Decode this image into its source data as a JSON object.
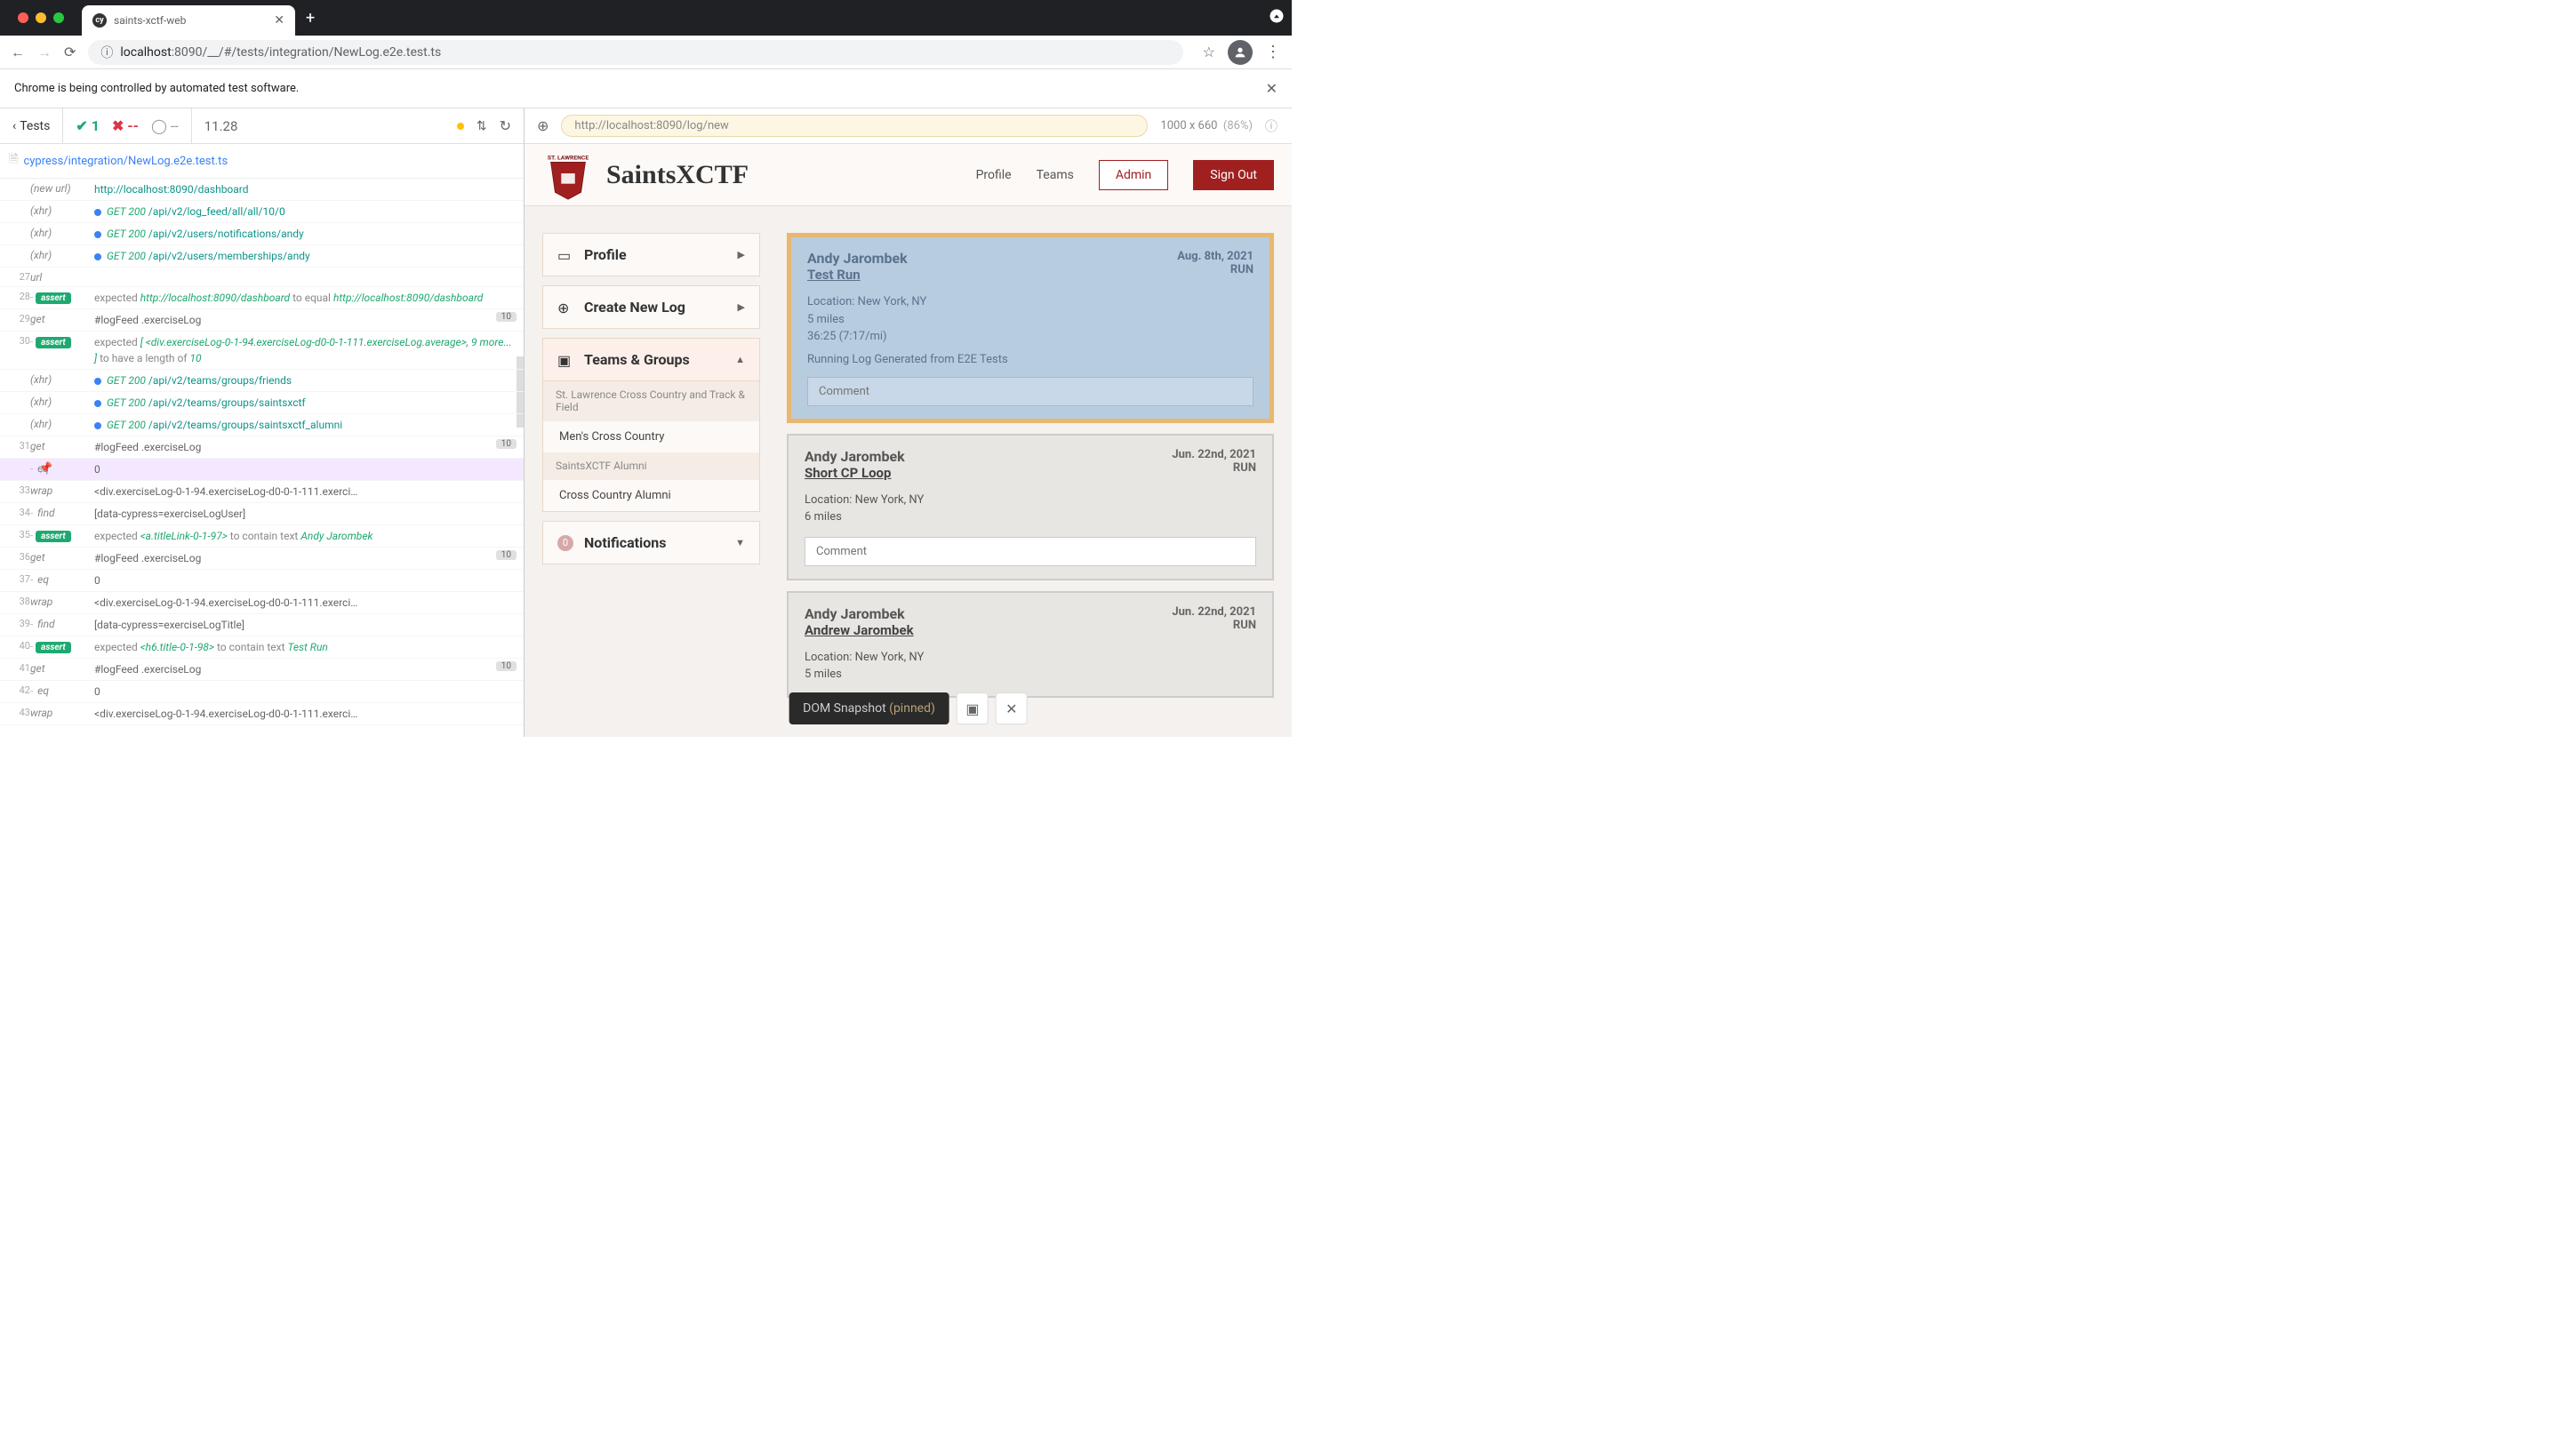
{
  "browser": {
    "tab_title": "saints-xctf-web",
    "url_host": "localhost",
    "url_port_path": ":8090/__/#/tests/integration/NewLog.e2e.test.ts",
    "automation_msg": "Chrome is being controlled by automated test software."
  },
  "cypress": {
    "tests_label": "Tests",
    "pass_count": "1",
    "fail_count": "--",
    "pending_count": "--",
    "duration": "11.28",
    "file_path": "cypress/integration/NewLog.e2e.test.ts",
    "preview_url": "http://localhost:8090/log/new",
    "viewport_size": "1000 x 660",
    "viewport_pct": "(86%)",
    "snapshot_label": "DOM Snapshot",
    "snapshot_state": "(pinned)",
    "commands": [
      {
        "num": "",
        "name": "(new url)",
        "msg_parts": [
          {
            "t": "teal",
            "v": "http://localhost:8090/dashboard"
          }
        ]
      },
      {
        "num": "",
        "name": "(xhr)",
        "dot": true,
        "msg_parts": [
          {
            "t": "green",
            "v": "GET 200 "
          },
          {
            "t": "teal",
            "v": "/api/v2/log_feed/all/all/10/0"
          }
        ]
      },
      {
        "num": "",
        "name": "(xhr)",
        "dot": true,
        "msg_parts": [
          {
            "t": "green",
            "v": "GET 200 "
          },
          {
            "t": "teal",
            "v": "/api/v2/users/notifications/andy"
          }
        ]
      },
      {
        "num": "",
        "name": "(xhr)",
        "dot": true,
        "msg_parts": [
          {
            "t": "green",
            "v": "GET 200 "
          },
          {
            "t": "teal",
            "v": "/api/v2/users/memberships/andy"
          }
        ]
      },
      {
        "num": "27",
        "name": "url",
        "msg_parts": []
      },
      {
        "num": "28",
        "name": "assert",
        "assert": true,
        "child": true,
        "msg_parts": [
          {
            "t": "exp",
            "v": "expected "
          },
          {
            "t": "green",
            "v": "http://localhost:8090/dashboard"
          },
          {
            "t": "exp",
            "v": " to equal "
          },
          {
            "t": "green",
            "v": "http://localhost:8090/dashboard"
          }
        ]
      },
      {
        "num": "29",
        "name": "get",
        "msg_parts": [
          {
            "t": "plain",
            "v": "#logFeed .exerciseLog"
          }
        ],
        "badge": "10"
      },
      {
        "num": "30",
        "name": "assert",
        "assert": true,
        "child": true,
        "msg_parts": [
          {
            "t": "exp",
            "v": "expected "
          },
          {
            "t": "green",
            "v": "[ <div.exerciseLog-0-1-94.exerciseLog-d0-0-1-111.exerciseLog.average>, 9 more... ]"
          },
          {
            "t": "exp",
            "v": " to have a length of "
          },
          {
            "t": "green",
            "v": "10"
          }
        ]
      },
      {
        "num": "",
        "name": "(xhr)",
        "dot": true,
        "msg_parts": [
          {
            "t": "green",
            "v": "GET 200 "
          },
          {
            "t": "teal",
            "v": "/api/v2/teams/groups/friends"
          }
        ]
      },
      {
        "num": "",
        "name": "(xhr)",
        "dot": true,
        "msg_parts": [
          {
            "t": "green",
            "v": "GET 200 "
          },
          {
            "t": "teal",
            "v": "/api/v2/teams/groups/saintsxctf"
          }
        ]
      },
      {
        "num": "",
        "name": "(xhr)",
        "dot": true,
        "msg_parts": [
          {
            "t": "green",
            "v": "GET 200 "
          },
          {
            "t": "teal",
            "v": "/api/v2/teams/groups/saintsxctf_alumni"
          }
        ]
      },
      {
        "num": "31",
        "name": "get",
        "msg_parts": [
          {
            "t": "plain",
            "v": "#logFeed .exerciseLog"
          }
        ],
        "badge": "10"
      },
      {
        "num": "",
        "name": "eq",
        "child": true,
        "highlight": true,
        "pin": true,
        "msg_parts": [
          {
            "t": "plain",
            "v": "0"
          }
        ]
      },
      {
        "num": "33",
        "name": "wrap",
        "msg_parts": [
          {
            "t": "plain",
            "v": "<div.exerciseLog-0-1-94.exerciseLog-d0-0-1-111.exerci…"
          }
        ]
      },
      {
        "num": "34",
        "name": "find",
        "child": true,
        "msg_parts": [
          {
            "t": "plain",
            "v": "[data-cypress=exerciseLogUser]"
          }
        ]
      },
      {
        "num": "35",
        "name": "assert",
        "assert": true,
        "child": true,
        "msg_parts": [
          {
            "t": "exp",
            "v": "expected "
          },
          {
            "t": "green",
            "v": "<a.titleLink-0-1-97>"
          },
          {
            "t": "exp",
            "v": " to contain text "
          },
          {
            "t": "green",
            "v": "Andy Jarombek"
          }
        ]
      },
      {
        "num": "36",
        "name": "get",
        "msg_parts": [
          {
            "t": "plain",
            "v": "#logFeed .exerciseLog"
          }
        ],
        "badge": "10"
      },
      {
        "num": "37",
        "name": "eq",
        "child": true,
        "msg_parts": [
          {
            "t": "plain",
            "v": "0"
          }
        ]
      },
      {
        "num": "38",
        "name": "wrap",
        "msg_parts": [
          {
            "t": "plain",
            "v": "<div.exerciseLog-0-1-94.exerciseLog-d0-0-1-111.exerci…"
          }
        ]
      },
      {
        "num": "39",
        "name": "find",
        "child": true,
        "msg_parts": [
          {
            "t": "plain",
            "v": "[data-cypress=exerciseLogTitle]"
          }
        ]
      },
      {
        "num": "40",
        "name": "assert",
        "assert": true,
        "child": true,
        "msg_parts": [
          {
            "t": "exp",
            "v": "expected "
          },
          {
            "t": "green",
            "v": "<h6.title-0-1-98>"
          },
          {
            "t": "exp",
            "v": " to contain text "
          },
          {
            "t": "green",
            "v": "Test Run"
          }
        ]
      },
      {
        "num": "41",
        "name": "get",
        "msg_parts": [
          {
            "t": "plain",
            "v": "#logFeed .exerciseLog"
          }
        ],
        "badge": "10"
      },
      {
        "num": "42",
        "name": "eq",
        "child": true,
        "msg_parts": [
          {
            "t": "plain",
            "v": "0"
          }
        ]
      },
      {
        "num": "43",
        "name": "wrap",
        "msg_parts": [
          {
            "t": "plain",
            "v": "<div.exerciseLog-0-1-94.exerciseLog-d0-0-1-111.exerci…"
          }
        ]
      }
    ]
  },
  "app": {
    "logo_text_top": "ST. LAWRENCE",
    "title": "SaintsXCTF",
    "nav": {
      "profile": "Profile",
      "teams": "Teams",
      "admin": "Admin",
      "signout": "Sign Out"
    },
    "sidebar": {
      "profile": "Profile",
      "create_log": "Create New Log",
      "teams_groups": "Teams & Groups",
      "notifications": "Notifications",
      "notif_count": "0",
      "team1_header": "St. Lawrence Cross Country and Track & Field",
      "team1_item": "Men's Cross Country",
      "team2_header": "SaintsXCTF Alumni",
      "team2_item": "Cross Country Alumni"
    },
    "comment_placeholder": "Comment",
    "logs": [
      {
        "user": "Andy Jarombek",
        "date": "Aug. 8th, 2021",
        "title": "Test Run",
        "type": "RUN",
        "location": "Location: New York, NY",
        "distance": "5 miles",
        "time": "36:25 (7:17/mi)",
        "desc": "Running Log Generated from E2E Tests",
        "highlighted": true
      },
      {
        "user": "Andy Jarombek",
        "date": "Jun. 22nd, 2021",
        "title": "Short CP Loop",
        "type": "RUN",
        "location": "Location: New York, NY",
        "distance": "6 miles",
        "time": "",
        "desc": "",
        "highlighted": false
      },
      {
        "user": "Andy Jarombek",
        "date": "Jun. 22nd, 2021",
        "title": "Andrew Jarombek",
        "type": "RUN",
        "location": "Location: New York, NY",
        "distance": "5 miles",
        "time": "",
        "desc": "",
        "highlighted": false
      }
    ]
  }
}
